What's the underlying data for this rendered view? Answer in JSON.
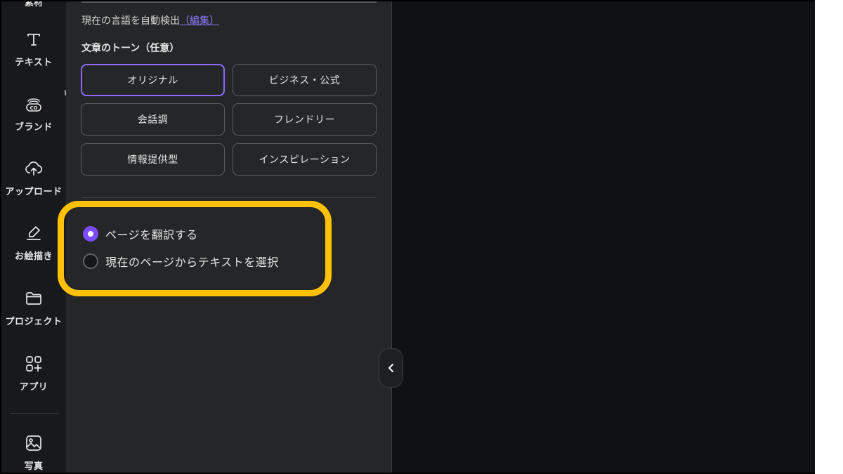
{
  "rail": {
    "top_cut_label": "素材",
    "items": [
      {
        "label": "テキスト",
        "icon": "text-icon"
      },
      {
        "label": "ブランド",
        "icon": "brand-icon"
      },
      {
        "label": "アップロード",
        "icon": "upload-cloud-icon"
      },
      {
        "label": "お絵描き",
        "icon": "draw-icon"
      },
      {
        "label": "プロジェクト",
        "icon": "folder-icon"
      },
      {
        "label": "アプリ",
        "icon": "apps-icon"
      },
      {
        "label": "写真",
        "icon": "photo-icon"
      }
    ],
    "crown_icon": "♛"
  },
  "panel": {
    "language_line": "現在の言語を自動検出",
    "language_edit_link": "（編集）",
    "tone_title": "文章のトーン（任意）",
    "tones": [
      {
        "label": "オリジナル",
        "selected": true
      },
      {
        "label": "ビジネス・公式",
        "selected": false
      },
      {
        "label": "会話調",
        "selected": false
      },
      {
        "label": "フレンドリー",
        "selected": false
      },
      {
        "label": "情報提供型",
        "selected": false
      },
      {
        "label": "インスピレーション",
        "selected": false
      }
    ],
    "options": [
      {
        "label": "ページを翻訳する",
        "checked": true
      },
      {
        "label": "現在のページからテキストを選択",
        "checked": false
      }
    ],
    "highlight_color": "#ffc107",
    "accent_color": "#8b6cff"
  },
  "collapse_icon": "chevron-left-icon"
}
